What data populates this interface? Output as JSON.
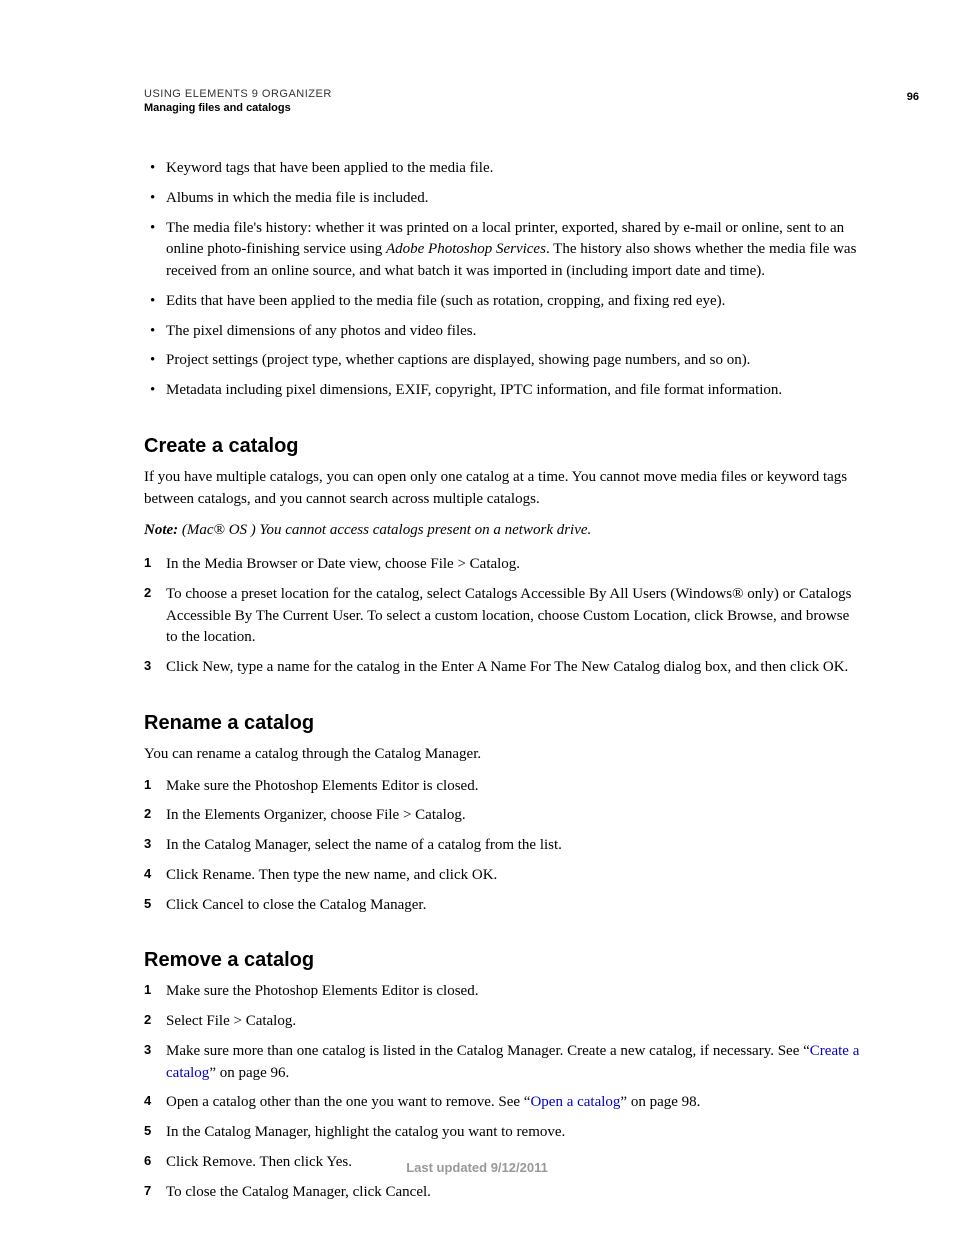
{
  "header": {
    "title": "USING ELEMENTS 9 ORGANIZER",
    "subtitle": "Managing files and catalogs",
    "page_number": "96"
  },
  "top_bullets": [
    "Keyword tags that have been applied to the media file.",
    "Albums in which the media file is included.",
    "Edits that have been applied to the media file (such as rotation, cropping, and fixing red eye).",
    "The pixel dimensions of any photos and video files.",
    "Project settings (project type, whether captions are displayed, showing page numbers, and so on).",
    "Metadata including pixel dimensions, EXIF, copyright, IPTC information, and file format information."
  ],
  "history_bullet": {
    "pre": "The media file's history: whether it was printed on a local printer, exported, shared by e-mail or online, sent to an online photo-finishing service using ",
    "italic": "Adobe Photoshop Services",
    "post": ". The history also shows whether the media file was received from an online source, and what batch it was imported in (including import date and time)."
  },
  "sections": {
    "create": {
      "heading": "Create a catalog",
      "intro": "If you have multiple catalogs, you can open only one catalog at a time. You cannot move media files or keyword tags between catalogs, and you cannot search across multiple catalogs.",
      "note_label": "Note:",
      "note_body": " (Mac® OS ) You cannot access catalogs present on a network drive.",
      "steps": [
        "In the Media Browser or Date view, choose File > Catalog.",
        "To choose a preset location for the catalog, select Catalogs Accessible By All Users (Windows® only) or Catalogs Accessible By The Current User. To select a custom location, choose Custom Location, click Browse, and browse to the location.",
        "Click New, type a name for the catalog in the Enter A Name For The New Catalog dialog box, and then click OK."
      ]
    },
    "rename": {
      "heading": "Rename a catalog",
      "intro": "You can rename a catalog through the Catalog Manager.",
      "steps": [
        "Make sure the Photoshop Elements Editor is closed.",
        "In the Elements Organizer, choose File > Catalog.",
        "In the Catalog Manager, select the name of a catalog from the list.",
        "Click Rename. Then type the new name, and click OK.",
        "Click Cancel to close the Catalog Manager."
      ]
    },
    "remove": {
      "heading": "Remove a catalog",
      "steps_plain": {
        "s1": "Make sure the Photoshop Elements Editor is closed.",
        "s2": "Select File > Catalog.",
        "s5": "In the Catalog Manager, highlight the catalog you want to remove.",
        "s6": "Click Remove. Then click Yes.",
        "s7": "To close the Catalog Manager, click Cancel."
      },
      "step3": {
        "pre": "Make sure more than one catalog is listed in the Catalog Manager. Create a new catalog, if necessary. See “",
        "link": "Create a catalog",
        "post": "” on page 96."
      },
      "step4": {
        "pre": "Open a catalog other than the one you want to remove. See “",
        "link": "Open a catalog",
        "post": "” on page 98."
      }
    }
  },
  "footer": "Last updated 9/12/2011"
}
